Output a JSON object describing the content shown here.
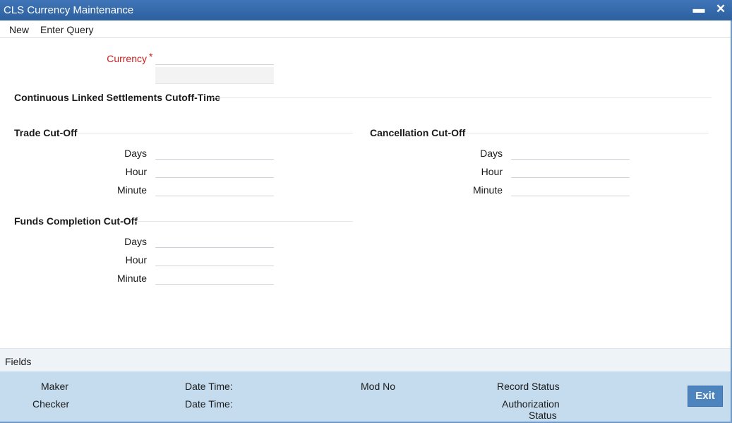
{
  "window": {
    "title": "CLS Currency Maintenance",
    "minimize_glyph": "▬",
    "close_glyph": "✕"
  },
  "menu": {
    "new_label": "New",
    "enter_query_label": "Enter Query"
  },
  "currency": {
    "label": "Currency",
    "required_mark": "*",
    "value": "",
    "description": ""
  },
  "cls_section": {
    "title": "Continuous Linked Settlements Cutoff-Time"
  },
  "trade": {
    "title": "Trade Cut-Off",
    "days_label": "Days",
    "days_value": "",
    "hour_label": "Hour",
    "hour_value": "",
    "minute_label": "Minute",
    "minute_value": ""
  },
  "cancellation": {
    "title": "Cancellation Cut-Off",
    "days_label": "Days",
    "days_value": "",
    "hour_label": "Hour",
    "hour_value": "",
    "minute_label": "Minute",
    "minute_value": ""
  },
  "funds": {
    "title": "Funds Completion Cut-Off",
    "days_label": "Days",
    "days_value": "",
    "hour_label": "Hour",
    "hour_value": "",
    "minute_label": "Minute",
    "minute_value": ""
  },
  "fields_bar": {
    "label": "Fields"
  },
  "footer": {
    "maker": "Maker",
    "checker": "Checker",
    "date_time_1": "Date Time:",
    "date_time_2": "Date Time:",
    "mod_no": "Mod No",
    "record_status": "Record Status",
    "authorization_line1": "Authorization",
    "authorization_line2": "Status",
    "exit_label": "Exit"
  },
  "colors": {
    "titlebar": "#2d5f9e",
    "required_red": "#c8201d",
    "footer_bg": "#c4dcee",
    "exit_button": "#4d84be"
  }
}
